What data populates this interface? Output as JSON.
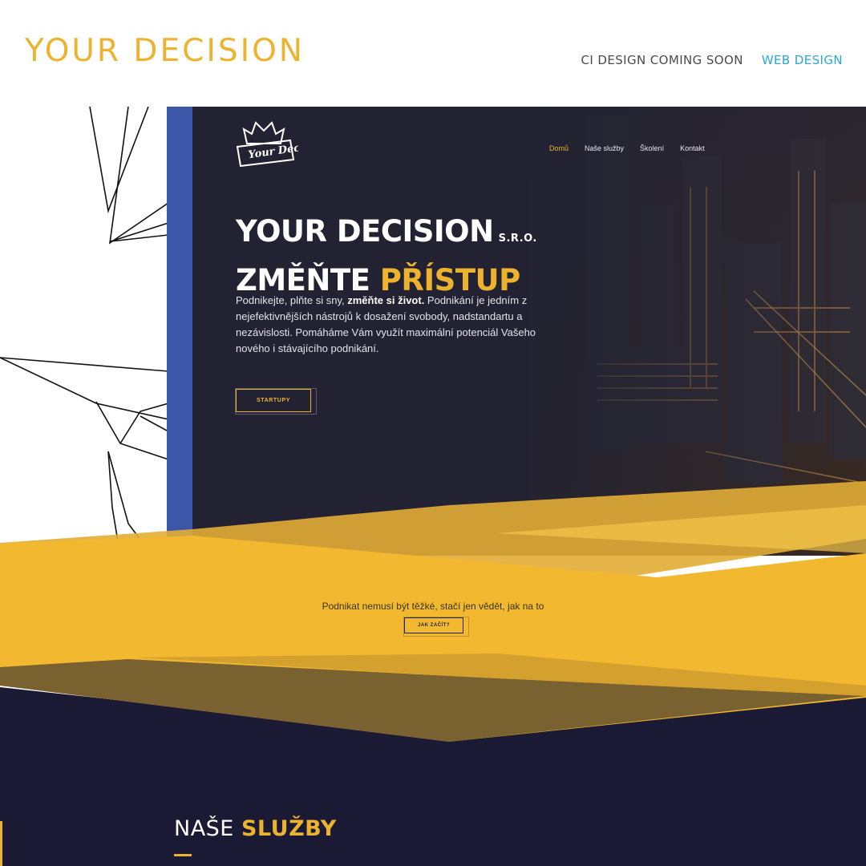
{
  "header": {
    "brand": "YOUR DECISION",
    "nav": [
      {
        "label": "CI DESIGN COMING SOON",
        "active": false
      },
      {
        "label": "WEB DESIGN",
        "active": true
      }
    ]
  },
  "site": {
    "logo_text": "Your Decision",
    "nav": [
      "Domů",
      "Naše služby",
      "Školení",
      "Kontakt"
    ],
    "hero": {
      "title": "YOUR DECISION",
      "title_suffix": "S.R.O.",
      "subtitle_a": "ZMĚŇTE",
      "subtitle_b": "PŘÍSTUP",
      "text_1": "Podnikejte, plňte si sny, ",
      "text_bold": "změňte si život.",
      "text_2": " Podnikání je jedním z nejefektivnějších nástrojů k dosažení svobody, nadstandartu a nezávislosti. Pomáháme Vám využít maximální potenciál Vašeho nového i stávajícího podnikání.",
      "button": "STARTUPY"
    },
    "cta": {
      "text": "Podnikat nemusí být těžké, stačí jen vědět, jak na to",
      "button": "JAK ZAČÍT?"
    },
    "services": {
      "title_a": "NAŠE",
      "title_b": "SLUŽBY"
    }
  },
  "colors": {
    "accent": "#edb32f",
    "dark": "#222232",
    "navy": "#1b1a35",
    "blue": "#3c57a8",
    "link": "#2aa7d9"
  }
}
